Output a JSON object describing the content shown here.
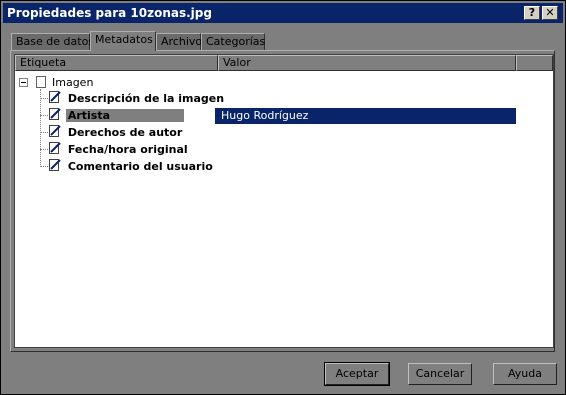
{
  "window": {
    "title": "Propiedades para 10zonas.jpg"
  },
  "titlebar_buttons": {
    "help_label": "?",
    "close_label": "✕"
  },
  "tabs": [
    {
      "label": "Base de datos"
    },
    {
      "label": "Metadatos"
    },
    {
      "label": "Archivo"
    },
    {
      "label": "Categorías"
    }
  ],
  "columns": {
    "label": "Etiqueta",
    "value": "Valor"
  },
  "tree": {
    "root": {
      "label": "Imagen",
      "expander": "⊟",
      "icon": "document-icon"
    },
    "items": [
      {
        "label": "Descripción de la imagen",
        "value": "",
        "icon": "edit-document-icon",
        "selected": false
      },
      {
        "label": "Artista",
        "value": "Hugo Rodríguez",
        "icon": "edit-document-icon",
        "selected": true
      },
      {
        "label": "Derechos de autor",
        "value": "",
        "icon": "edit-document-icon",
        "selected": false
      },
      {
        "label": "Fecha/hora original",
        "value": "",
        "icon": "edit-document-icon",
        "selected": false
      },
      {
        "label": "Comentario del usuario",
        "value": "",
        "icon": "edit-document-icon",
        "selected": false
      }
    ]
  },
  "buttons": {
    "accept": "Aceptar",
    "cancel": "Cancelar",
    "help": "Ayuda"
  },
  "colors": {
    "titlebar": "#0a246a",
    "selection": "#0a246a",
    "face": "#7f7f7f"
  }
}
